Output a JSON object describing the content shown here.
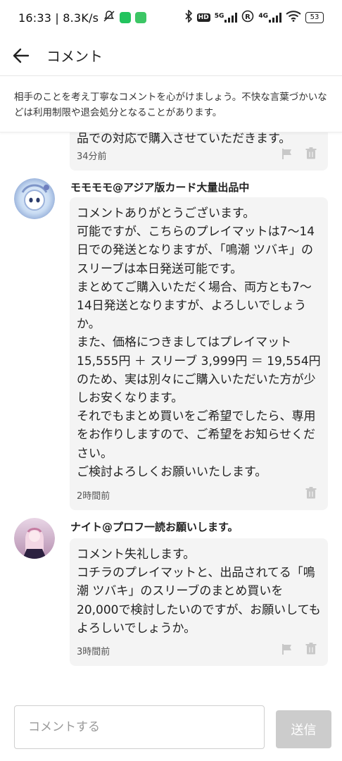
{
  "status_bar": {
    "time_speed": "16:33 | 8.3K/s",
    "network_5g": "5G",
    "network_4g": "4G",
    "hd": "HD",
    "battery": "53"
  },
  "header": {
    "title": "コメント"
  },
  "notice": "相手のことを考え丁寧なコメントを心がけましょう。不快な言葉づかいなどは利用制限や退会処分となることがあります。",
  "comments": [
    {
      "text": "品での対応で購入させていただきます。",
      "time": "34分前"
    },
    {
      "user": "モモモモ@アジア版カード大量出品中",
      "text": "コメントありがとうございます。\n可能ですが、こちらのプレイマットは7〜14日での発送となりますが、「鳴潮 ツバキ」のスリーブは本日発送可能です。\nまとめてご購入いただく場合、両方とも7〜14日発送となりますが、よろしいでしょうか。\nまた、価格につきましてはプレイマット15,555円 ＋ スリーブ 3,999円 ＝ 19,554円 のため、実は別々にご購入いただいた方が少しお安くなります。\nそれでもまとめ買いをご希望でしたら、専用をお作りしますので、ご希望をお知らせください。\nご検討よろしくお願いいたします。",
      "time": "2時間前"
    },
    {
      "user": "ナイト@プロフ一読お願いします。",
      "text": "コメント失礼します。\nコチラのプレイマットと、出品されてる「鳴潮 ツバキ」のスリーブのまとめ買いを20,000で検討したいのですが、お願いしてもよろしいでしょうか。",
      "time": "3時間前"
    }
  ],
  "composer": {
    "placeholder": "コメントする",
    "send_label": "送信"
  }
}
